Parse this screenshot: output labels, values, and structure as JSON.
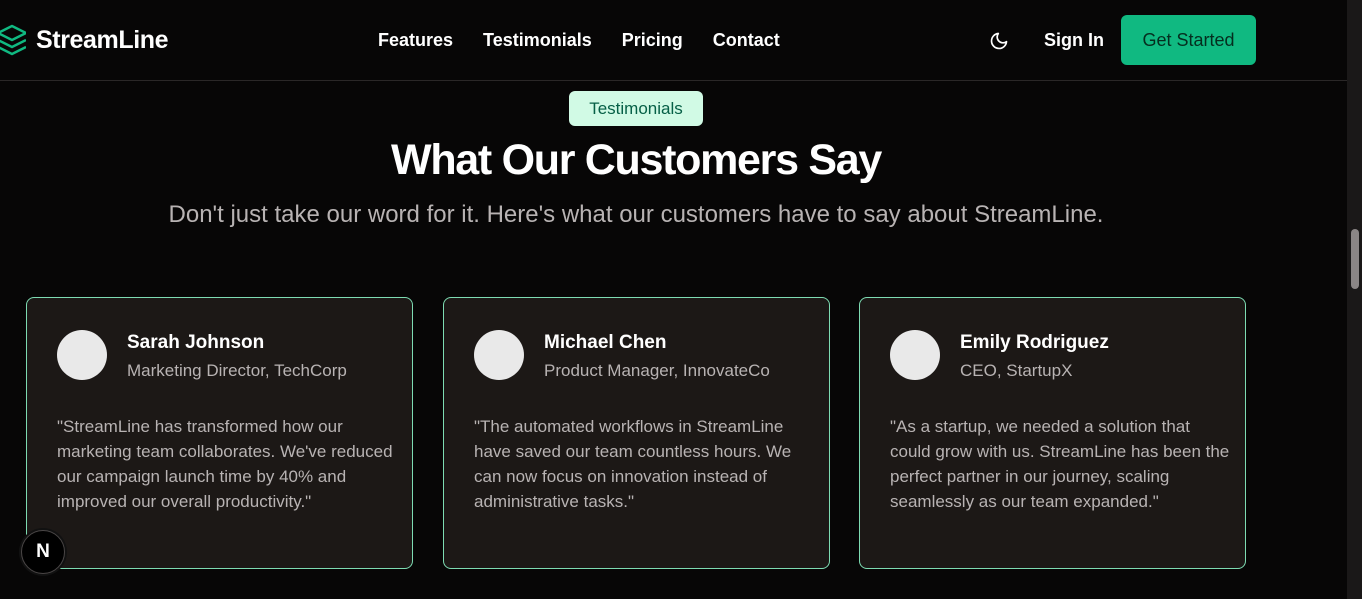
{
  "brand": {
    "name": "StreamLine",
    "icon": "layers-icon",
    "accent": "#10b981"
  },
  "nav": {
    "links": [
      {
        "label": "Features"
      },
      {
        "label": "Testimonials"
      },
      {
        "label": "Pricing"
      },
      {
        "label": "Contact"
      }
    ],
    "theme_icon": "moon-icon",
    "signin_label": "Sign In",
    "cta_label": "Get Started"
  },
  "section": {
    "badge": "Testimonials",
    "title": "What Our Customers Say",
    "subtitle": "Don't just take our word for it. Here's what our customers have to say about StreamLine."
  },
  "testimonials": [
    {
      "name": "Sarah Johnson",
      "role": "Marketing Director, TechCorp",
      "quote": "\"StreamLine has transformed how our marketing team collaborates. We've reduced our campaign launch time by 40% and improved our overall productivity.\""
    },
    {
      "name": "Michael Chen",
      "role": "Product Manager, InnovateCo",
      "quote": "\"The automated workflows in StreamLine have saved our team countless hours. We can now focus on innovation instead of administrative tasks.\""
    },
    {
      "name": "Emily Rodriguez",
      "role": "CEO, StartupX",
      "quote": "\"As a startup, we needed a solution that could grow with us. StreamLine has been the perfect partner in our journey, scaling seamlessly as our team expanded.\""
    }
  ],
  "dev_badge": {
    "letter": "N"
  }
}
